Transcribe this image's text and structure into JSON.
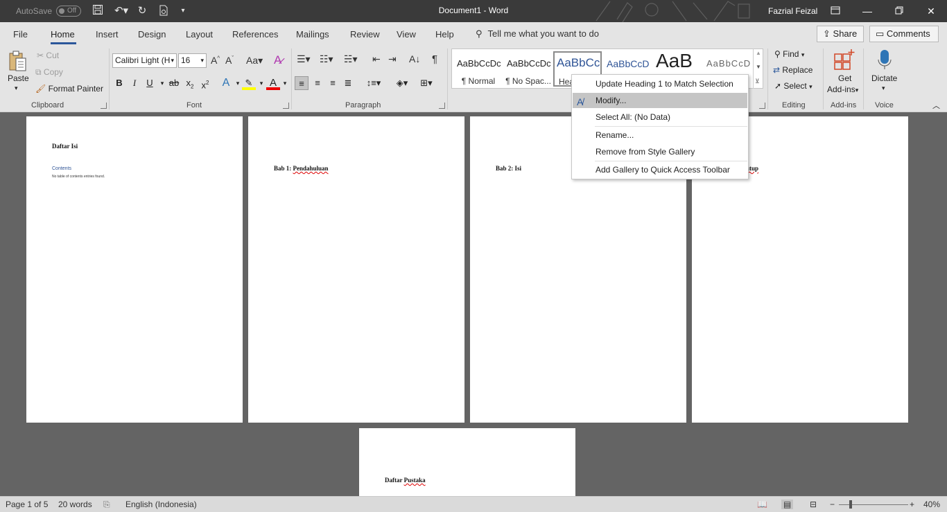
{
  "titlebar": {
    "autosave_label": "AutoSave",
    "autosave_state": "Off",
    "document_title": "Document1 - Word",
    "user_name": "Fazrial Feizal"
  },
  "tabs": [
    "File",
    "Home",
    "Insert",
    "Design",
    "Layout",
    "References",
    "Mailings",
    "Review",
    "View",
    "Help"
  ],
  "tell_me": "Tell me what you want to do",
  "share_label": "Share",
  "comments_label": "Comments",
  "clipboard": {
    "paste": "Paste",
    "cut": "Cut",
    "copy": "Copy",
    "format_painter": "Format Painter",
    "group_label": "Clipboard"
  },
  "font": {
    "family": "Calibri Light (H",
    "size": "16",
    "group_label": "Font"
  },
  "paragraph": {
    "group_label": "Paragraph"
  },
  "styles": {
    "items": [
      {
        "sample": "AaBbCcDc",
        "name": "¶ Normal"
      },
      {
        "sample": "AaBbCcDc",
        "name": "¶ No Spac..."
      },
      {
        "sample": "AaBbCc",
        "name": "Hea"
      },
      {
        "sample": "AaBbCcD",
        "name": ""
      },
      {
        "sample": "AaB",
        "name": ""
      },
      {
        "sample": "AaBbCcD",
        "name": ""
      }
    ]
  },
  "editing": {
    "find": "Find",
    "replace": "Replace",
    "select": "Select",
    "group_label": "Editing"
  },
  "addins": {
    "get": "Get",
    "addins": "Add-ins",
    "group_label": "Add-ins"
  },
  "voice": {
    "dictate": "Dictate",
    "group_label": "Voice"
  },
  "context_menu": {
    "items": [
      "Update Heading 1 to Match Selection",
      "Modify...",
      "Select All: (No Data)",
      "Rename...",
      "Remove from Style Gallery",
      "Add Gallery to Quick Access Toolbar"
    ]
  },
  "pages": {
    "p1_heading": "Daftar Isi",
    "p1_contents": "Contents",
    "p1_note": "No table of contents entries found.",
    "p2_heading": "Bab 1: Pendahuluan",
    "p3_heading": "Bab 2: Isi",
    "p4_heading_visible": "utup",
    "p5_heading": "Daftar Pustaka"
  },
  "status": {
    "page": "Page 1 of 5",
    "words": "20 words",
    "language": "English (Indonesia)",
    "zoom": "40%"
  },
  "colors": {
    "accent": "#2b579a",
    "titlebar": "#3a3a3a",
    "ribbon": "#e4e4e4",
    "workspace": "#646464"
  }
}
